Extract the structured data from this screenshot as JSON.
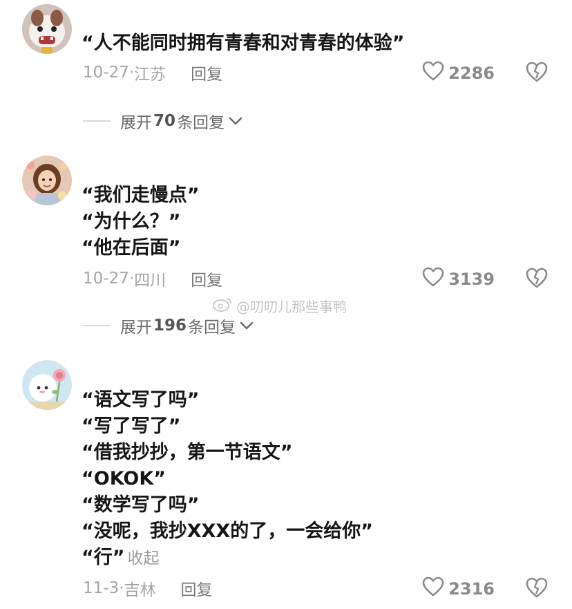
{
  "comments": [
    {
      "lines": [
        "“人不能同时拥有青春和对青春的体验”"
      ],
      "date": "10-27",
      "location": "江苏",
      "reply_label": "回复",
      "likes": "2286",
      "expand": {
        "prefix": "展开",
        "count": "70",
        "suffix": "条回复"
      }
    },
    {
      "lines": [
        "“我们走慢点”",
        "“为什么？”",
        "“他在后面”"
      ],
      "date": "10-27",
      "location": "四川",
      "reply_label": "回复",
      "likes": "3139",
      "expand": {
        "prefix": "展开",
        "count": "196",
        "suffix": "条回复"
      }
    },
    {
      "lines": [
        "“语文写了吗”",
        "“写了写了”",
        "“借我抄抄，第一节语文”",
        "“OKOK”",
        "“数学写了吗”",
        "“没呢，我抄XXX的了，一会给你”",
        "“行”"
      ],
      "collapse_label": "收起",
      "date": "11-3",
      "location": "吉林",
      "reply_label": "回复",
      "likes": "2316"
    }
  ],
  "watermark": "@叨叨儿那些事鸭",
  "icons": {
    "like": "heart-outline-icon",
    "dislike": "broken-heart-icon",
    "expand": "chevron-down-icon",
    "watermark": "weibo-logo-icon"
  }
}
